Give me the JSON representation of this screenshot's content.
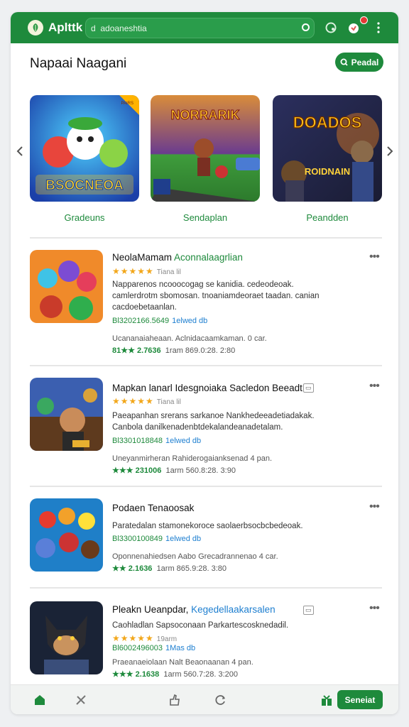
{
  "app": {
    "name": "Aplttk",
    "logo_icon": "leaf-icon"
  },
  "search": {
    "value": "d  adoaneshtia",
    "placeholder": ""
  },
  "colors": {
    "brand": "#1e8a3c",
    "star": "#f2a71b",
    "link": "#1e7fd0",
    "badge": "#e53935"
  },
  "header": {
    "title": "Napaai Naagani",
    "button_label": "Peadal"
  },
  "featured": [
    {
      "label": "Gradeuns",
      "art_text": "BSOCNEOA",
      "corner_tag": "PAIRS"
    },
    {
      "label": "Sendaplan",
      "art_text": "NORRARIK"
    },
    {
      "label": "Peandden",
      "art_text": "DOADOS",
      "sub_art_text": "ROIDNAIN"
    }
  ],
  "apps": [
    {
      "title": "NeolaMamam",
      "subtitle": "Aconnalaagrlian",
      "rating": "★★★★★",
      "rating_count": "Tiana lil",
      "desc": "Napparenos ncooocogag se kanidia. cedeodeoak. camlerdrotm sbomosan. tnoaniamdeoraet taadan. canian cacdoebetaanlan.",
      "price": "Bl3202166.5649",
      "price_ext": "1elwed db",
      "meta": "Ucananaiaheaan.  Aclnidacaamkaman. 0 car.",
      "foot_rating": "81★★ 2.7636",
      "foot_info": "1ram  869.0:28. 2:80"
    },
    {
      "title": "Mapkan lanarl Idesgnoiaka Sacledon Beeadt",
      "subtitle": "",
      "rating": "★★★★★",
      "rating_count": "Tiana lil",
      "desc": "Paeapanhan srerans sarkanoe  Nankhedeeadetiadakak. Canbola danilkenadenbtdekalandeanadetalam.",
      "price": "Bl3301018848",
      "price_ext": "1elwed db",
      "meta": "Uneyanmirheran  Rahiderogaianksenad 4 pan.",
      "foot_rating": "★★★ 231006",
      "foot_info": "1arm  560.8:28. 3:90"
    },
    {
      "title": "Podaen Tenaoosak",
      "subtitle": "",
      "rating": "",
      "rating_count": "",
      "desc": "Paratedalan stamonekoroce saolaerbsocbcbedeoak.",
      "price": "Bl3300100849",
      "price_ext": "1elwed db",
      "meta": "Oponnenahiedsen Aabo Grecadrannenao 4 car.",
      "foot_rating": "★★ 2.1636",
      "foot_info": "1arm  865.9:28. 3:80"
    },
    {
      "title": "Pleakn Ueanpdar,",
      "subtitle": "Kegedellaakarsalen",
      "rating": "★★★★★",
      "rating_count": "19arm",
      "desc": "Caohladlan Sapsoconaan Parkartescosknedadil.",
      "price": "Bl6002496003",
      "price_ext": "1Mas db",
      "meta": "Praeanaeiolaan Nalt Beaonaanan 4 pan.",
      "foot_rating": "★★★ 2.1638",
      "foot_info": "1arm  560.7:28. 3:200"
    }
  ],
  "bottom_nav": {
    "icons": [
      "home-icon",
      "tools-icon",
      "thumbs-up-icon",
      "refresh-icon",
      "gift-icon"
    ],
    "button_label": "Seneiat"
  }
}
